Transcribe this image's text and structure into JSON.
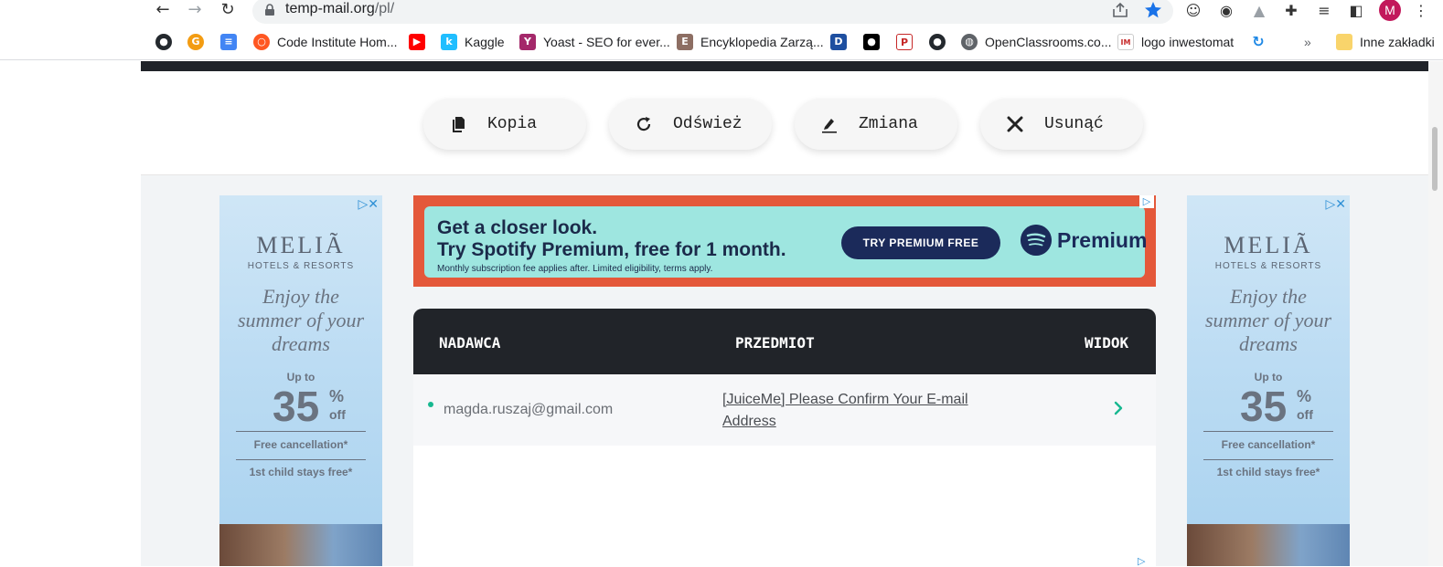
{
  "browser": {
    "url_host": "temp-mail.org",
    "url_path": "/pl/",
    "profile_initial": "M"
  },
  "bookmarks": {
    "items": [
      {
        "label": ""
      },
      {
        "label": ""
      },
      {
        "label": ""
      },
      {
        "label": "Code Institute Hom..."
      },
      {
        "label": ""
      },
      {
        "label": "Kaggle"
      },
      {
        "label": "Yoast - SEO for ever..."
      },
      {
        "label": "Encyklopedia Zarzą..."
      },
      {
        "label": ""
      },
      {
        "label": ""
      },
      {
        "label": ""
      },
      {
        "label": ""
      },
      {
        "label": "OpenClassrooms.co..."
      },
      {
        "label": "logo inwestomat"
      },
      {
        "label": ""
      }
    ],
    "overflow": "»",
    "other_folder": "Inne zakładki"
  },
  "actions": {
    "copy": "Kopia",
    "refresh": "Odśwież",
    "change": "Zmiana",
    "delete": "Usunąć"
  },
  "side_ad": {
    "brand": "MELIÃ",
    "brand_sub": "HOTELS & RESORTS",
    "tagline_1": "Enjoy the",
    "tagline_2": "summer of your",
    "tagline_3": "dreams",
    "up_to": "Up to",
    "discount": "35",
    "percent": "%",
    "off": "off",
    "line1": "Free cancellation*",
    "line2": "1st child stays free*"
  },
  "banner_ad": {
    "headline_1": "Get a closer look.",
    "headline_2": "Try Spotify Premium, free for 1 month.",
    "fine_print": "Monthly subscription fee applies after. Limited eligibility, terms apply.",
    "cta": "TRY PREMIUM FREE",
    "brand": "Premium"
  },
  "inbox": {
    "columns": {
      "sender": "NADAWCA",
      "subject": "PRZEDMIOT",
      "view": "WIDOK"
    },
    "messages": [
      {
        "sender": "magda.ruszaj@gmail.com",
        "subject": "[JuiceMe] Please Confirm Your E-mail Address"
      }
    ]
  },
  "colors": {
    "header_dark": "#212429",
    "accent_green": "#17b890",
    "ad_orange": "#e4583a",
    "ad_teal": "#9ee6e0"
  }
}
